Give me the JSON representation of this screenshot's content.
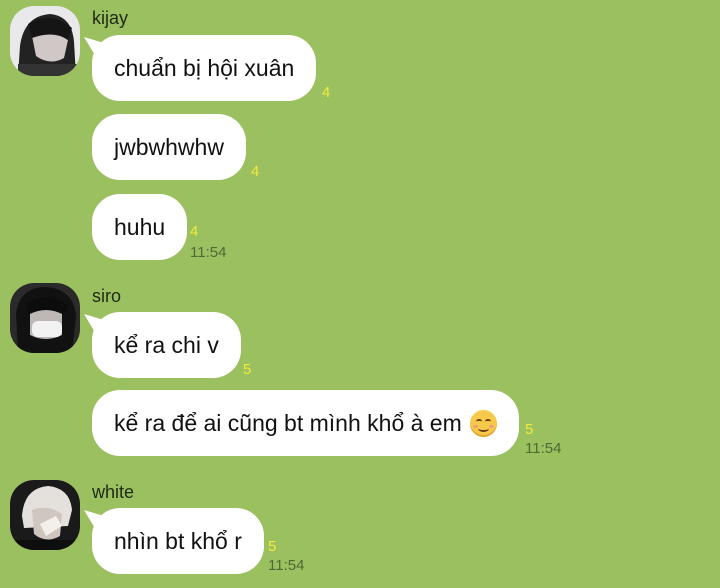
{
  "messages": [
    {
      "sender": "kijay",
      "avatar": "avatar-kijay",
      "bubbles": [
        {
          "text": "chuẩn bị hội xuân",
          "count": "4"
        },
        {
          "text": "jwbwhwhw",
          "count": "4"
        },
        {
          "text": "huhu",
          "count": "4",
          "time": "11:54"
        }
      ]
    },
    {
      "sender": "siro",
      "avatar": "avatar-siro",
      "bubbles": [
        {
          "text": "kể ra chi v",
          "count": "5"
        },
        {
          "text": "kể ra để ai cũng bt mình khổ à em",
          "emoji": "smiling-face-emoji",
          "count": "5",
          "time": "11:54"
        }
      ]
    },
    {
      "sender": "white",
      "avatar": "avatar-white",
      "bubbles": [
        {
          "text": "nhìn bt khổ r",
          "count": "5",
          "time": "11:54"
        }
      ]
    }
  ]
}
